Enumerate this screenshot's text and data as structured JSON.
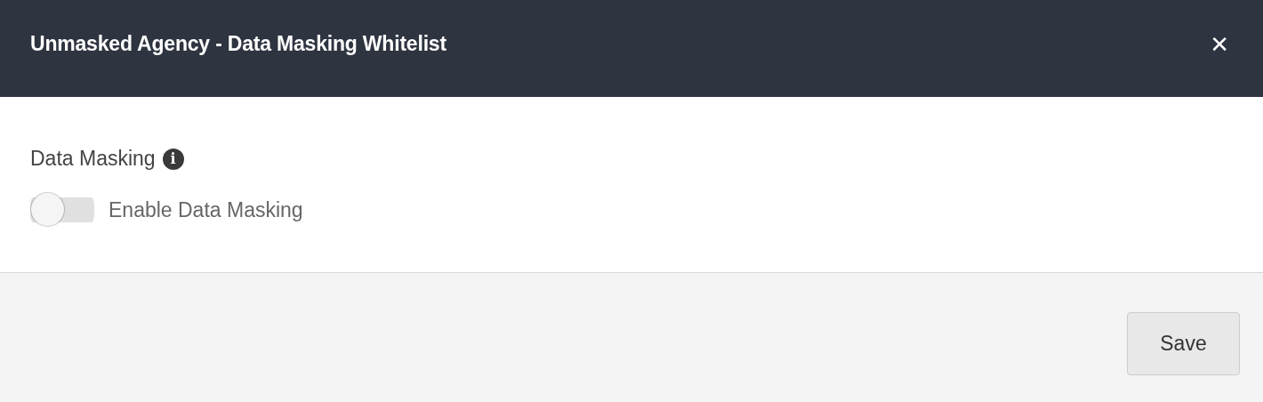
{
  "dialog": {
    "title": "Unmasked Agency - Data Masking Whitelist",
    "close": "✕"
  },
  "section": {
    "label": "Data Masking",
    "info": "i"
  },
  "toggle": {
    "label": "Enable Data Masking",
    "on": false
  },
  "buttons": [
    "Save"
  ]
}
